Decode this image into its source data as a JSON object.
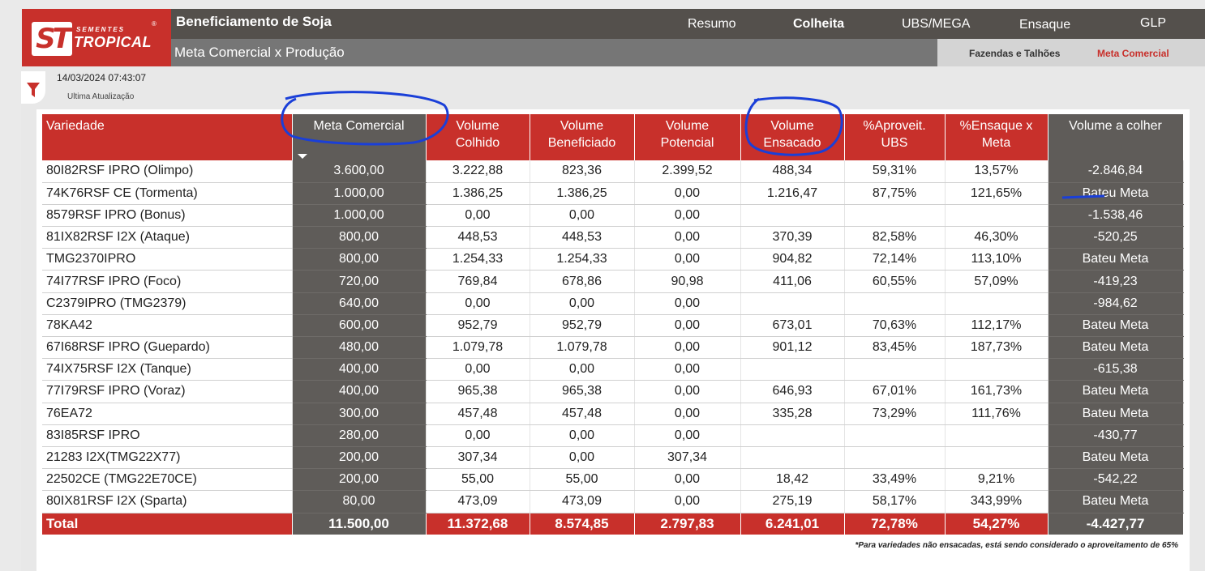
{
  "brand": {
    "small": "SEMENTES",
    "big": "TROPICAL",
    "mark": "ST",
    "reg": "®"
  },
  "app_title": "Beneficiamento de Soja",
  "subtitle": "Meta Comercial x Produção",
  "nav": [
    "Resumo",
    "Colheita",
    "UBS/MEGA",
    "Ensaque",
    "GLP"
  ],
  "nav_active": "Colheita",
  "subtabs": [
    "Fazendas e Talhões",
    "Meta Comercial"
  ],
  "subtab_active": "Meta Comercial",
  "timestamp": "14/03/2024 07:43:07",
  "timestamp_label": "Ultima Atualização",
  "colors": {
    "red": "#c8302b",
    "dark_grey": "#5f5c59",
    "topbar": "#54504c",
    "annotation": "#1a3fd8"
  },
  "table": {
    "headers": [
      [
        "Variedade"
      ],
      [
        "Meta Comercial"
      ],
      [
        "Volume",
        "Colhido"
      ],
      [
        "Volume",
        "Beneficiado"
      ],
      [
        "Volume",
        "Potencial"
      ],
      [
        "Volume",
        "Ensacado"
      ],
      [
        "%Aproveit.",
        "UBS"
      ],
      [
        "%Ensaque x",
        "Meta"
      ],
      [
        "Volume a colher"
      ]
    ],
    "rows": [
      [
        "80I82RSF IPRO (Olimpo)",
        "3.600,00",
        "3.222,88",
        "823,36",
        "2.399,52",
        "488,34",
        "59,31%",
        "13,57%",
        "-2.846,84"
      ],
      [
        "74K76RSF CE (Tormenta)",
        "1.000,00",
        "1.386,25",
        "1.386,25",
        "0,00",
        "1.216,47",
        "87,75%",
        "121,65%",
        "Bateu Meta"
      ],
      [
        "8579RSF IPRO (Bonus)",
        "1.000,00",
        "0,00",
        "0,00",
        "0,00",
        "",
        "",
        "",
        "-1.538,46"
      ],
      [
        "81IX82RSF I2X (Ataque)",
        "800,00",
        "448,53",
        "448,53",
        "0,00",
        "370,39",
        "82,58%",
        "46,30%",
        "-520,25"
      ],
      [
        "TMG2370IPRO",
        "800,00",
        "1.254,33",
        "1.254,33",
        "0,00",
        "904,82",
        "72,14%",
        "113,10%",
        "Bateu Meta"
      ],
      [
        "74I77RSF IPRO (Foco)",
        "720,00",
        "769,84",
        "678,86",
        "90,98",
        "411,06",
        "60,55%",
        "57,09%",
        "-419,23"
      ],
      [
        "C2379IPRO (TMG2379)",
        "640,00",
        "0,00",
        "0,00",
        "0,00",
        "",
        "",
        "",
        "-984,62"
      ],
      [
        "78KA42",
        "600,00",
        "952,79",
        "952,79",
        "0,00",
        "673,01",
        "70,63%",
        "112,17%",
        "Bateu Meta"
      ],
      [
        "67I68RSF IPRO (Guepardo)",
        "480,00",
        "1.079,78",
        "1.079,78",
        "0,00",
        "901,12",
        "83,45%",
        "187,73%",
        "Bateu Meta"
      ],
      [
        "74IX75RSF I2X (Tanque)",
        "400,00",
        "0,00",
        "0,00",
        "0,00",
        "",
        "",
        "",
        "-615,38"
      ],
      [
        "77I79RSF IPRO (Voraz)",
        "400,00",
        "965,38",
        "965,38",
        "0,00",
        "646,93",
        "67,01%",
        "161,73%",
        "Bateu Meta"
      ],
      [
        "76EA72",
        "300,00",
        "457,48",
        "457,48",
        "0,00",
        "335,28",
        "73,29%",
        "111,76%",
        "Bateu Meta"
      ],
      [
        "83I85RSF IPRO",
        "280,00",
        "0,00",
        "0,00",
        "0,00",
        "",
        "",
        "",
        "-430,77"
      ],
      [
        "21283 I2X(TMG22X77)",
        "200,00",
        "307,34",
        "0,00",
        "307,34",
        "",
        "",
        "",
        "Bateu Meta"
      ],
      [
        "22502CE (TMG22E70CE)",
        "200,00",
        "55,00",
        "55,00",
        "0,00",
        "18,42",
        "33,49%",
        "9,21%",
        "-542,22"
      ],
      [
        "80IX81RSF I2X (Sparta)",
        "80,00",
        "473,09",
        "473,09",
        "0,00",
        "275,19",
        "58,17%",
        "343,99%",
        "Bateu Meta"
      ]
    ],
    "total": [
      "Total",
      "11.500,00",
      "11.372,68",
      "8.574,85",
      "2.797,83",
      "6.241,01",
      "72,78%",
      "54,27%",
      "-4.427,77"
    ]
  },
  "footnote": "*Para variedades não ensacadas, está sendo considerado o aproveitamento de 65%"
}
